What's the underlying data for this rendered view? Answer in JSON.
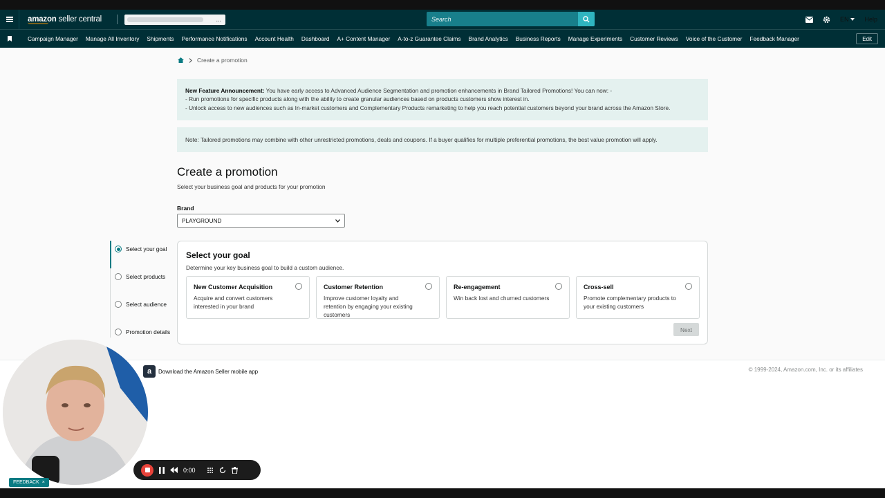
{
  "header": {
    "logo_brand": "amazon",
    "logo_suffix": "seller central",
    "account_ellipsis": "...",
    "search_placeholder": "Search",
    "language": "EN",
    "help": "Help"
  },
  "nav": {
    "items": [
      "Campaign Manager",
      "Manage All Inventory",
      "Shipments",
      "Performance Notifications",
      "Account Health",
      "Dashboard",
      "A+ Content Manager",
      "A-to-z Guarantee Claims",
      "Brand Analytics",
      "Business Reports",
      "Manage Experiments",
      "Customer Reviews",
      "Voice of the Customer",
      "Feedback Manager"
    ],
    "edit": "Edit"
  },
  "breadcrumb": {
    "current": "Create a promotion"
  },
  "announcement": {
    "title": "New Feature Announcement:",
    "intro": " You have early access to Advanced Audience Segmentation and promotion enhancements in Brand Tailored Promotions! You can now: -",
    "line1": "- Run promotions for specific products along with the ability to create granular audiences based on products customers show interest in.",
    "line2": "- Unlock access to new audiences such as In-market customers and Complementary Products remarketing to help you reach potential customers beyond your brand across the Amazon Store."
  },
  "note": "Note: Tailored promotions may combine with other unrestricted promotions, deals and coupons. If a buyer qualifies for multiple preferential promotions, the best value promotion will apply.",
  "page": {
    "title": "Create a promotion",
    "subtitle": "Select your business goal and products for your promotion",
    "brand_label": "Brand",
    "brand_value": "PLAYGROUND"
  },
  "steps": [
    {
      "label": "Select your goal",
      "active": true
    },
    {
      "label": "Select products",
      "active": false
    },
    {
      "label": "Select audience",
      "active": false
    },
    {
      "label": "Promotion details",
      "active": false
    }
  ],
  "goal": {
    "title": "Select your goal",
    "subtitle": "Determine your key business goal to build a custom audience.",
    "options": [
      {
        "title": "New Customer Acquisition",
        "desc": "Acquire and convert customers interested in your brand"
      },
      {
        "title": "Customer Retention",
        "desc": "Improve customer loyalty and retention by engaging your existing customers"
      },
      {
        "title": "Re-engagement",
        "desc": "Win back lost and churned customers"
      },
      {
        "title": "Cross-sell",
        "desc": "Promote complementary products to your existing customers"
      }
    ],
    "next": "Next"
  },
  "footer": {
    "app_download": "Download the Amazon Seller mobile app",
    "app_icon_letter": "a",
    "copyright": "© 1999-2024, Amazon.com, Inc. or its affiliates"
  },
  "recorder": {
    "time": "0:00"
  },
  "feedback": {
    "label": "FEEDBACK",
    "close": "×"
  },
  "colors": {
    "header_bg": "#002f36",
    "accent": "#0a7b83",
    "banner_bg": "#e4f1ef",
    "search_bg": "#187f8b"
  }
}
